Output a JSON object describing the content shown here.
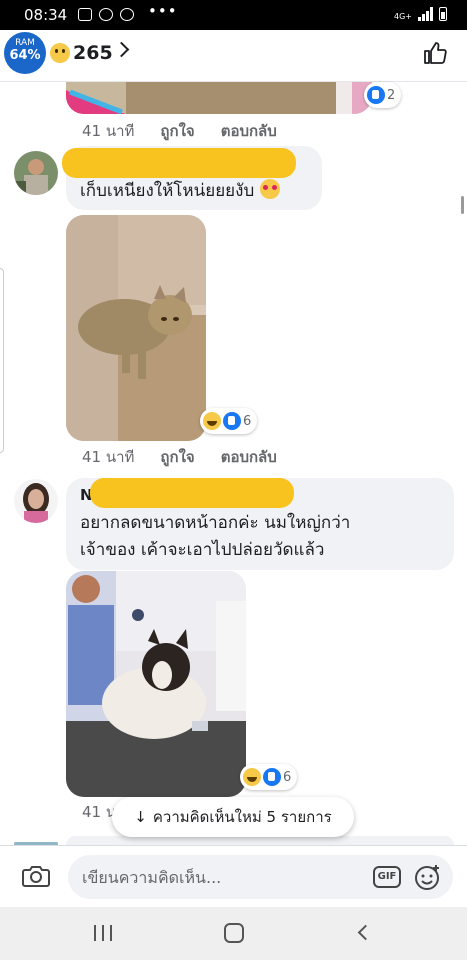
{
  "status_bar": {
    "time": "08:34",
    "dots": "•••",
    "network": "4G+"
  },
  "header": {
    "ram_label": "RAM",
    "ram_value": "64%",
    "reaction_count": "265"
  },
  "comments": [
    {
      "time": "41 นาที",
      "like": "ถูกใจ",
      "reply": "ตอบกลับ",
      "reaction_count": "2"
    },
    {
      "text": "เก็บเหนียงให้โหน่ยยยงับ",
      "time": "41 นาที",
      "like": "ถูกใจ",
      "reply": "ตอบกลับ",
      "reaction_count": "6",
      "name_initial": ""
    },
    {
      "name_initial": "N",
      "text_line1": "อยากลดขนาดหน้าอกค่ะ นมใหญ่กว่า",
      "text_line2": "เจ้าของ เค้าจะเอาไปปล่อยวัดแล้ว",
      "time": "41 น",
      "reaction_count": "6"
    }
  ],
  "toast": {
    "arrow": "↓",
    "label": "ความคิดเห็นใหม่ 5 รายการ"
  },
  "composer": {
    "placeholder": "เขียนความคิดเห็น...",
    "gif_label": "GIF"
  },
  "colors": {
    "accent": "#1877f2",
    "redaction": "#f9c31f",
    "bubble": "#f0f2f5"
  },
  "icons": [
    "gallery-icon",
    "chat-icon",
    "chrome-icon",
    "like-icon",
    "camera-icon",
    "gif-icon",
    "emoji-icon"
  ]
}
